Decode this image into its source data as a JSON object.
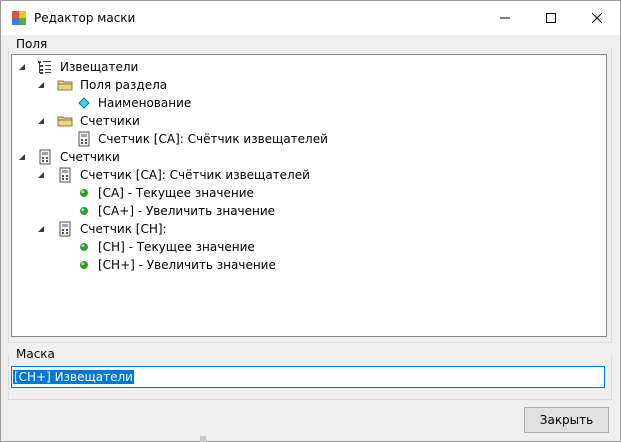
{
  "window": {
    "title": "Редактор маски"
  },
  "fields_group": {
    "label": "Поля"
  },
  "tree": [
    {
      "label": "Извещатели",
      "icon": "list-icon",
      "level": 0,
      "expanded": true
    },
    {
      "label": "Поля раздела",
      "icon": "folder-icon",
      "level": 1,
      "expanded": true
    },
    {
      "label": "Наименование",
      "icon": "diamond-icon",
      "level": 2,
      "expanded": null
    },
    {
      "label": "Счетчики",
      "icon": "folder-icon",
      "level": 1,
      "expanded": true
    },
    {
      "label": "Счетчик [СА]: Счётчик извещателей",
      "icon": "calculator-icon",
      "level": 2,
      "expanded": null
    },
    {
      "label": "Счетчики",
      "icon": "calculator-icon",
      "level": 0,
      "expanded": true
    },
    {
      "label": "Счетчик [СА]: Счётчик извещателей",
      "icon": "calculator-icon",
      "level": 1,
      "expanded": true
    },
    {
      "label": "[СА] - Текущее значение",
      "icon": "green-dot-icon",
      "level": 2,
      "expanded": null
    },
    {
      "label": "[СА+] - Увеличить значение",
      "icon": "green-dot-icon",
      "level": 2,
      "expanded": null
    },
    {
      "label": "Счетчик [СН]:",
      "icon": "calculator-icon",
      "level": 1,
      "expanded": true
    },
    {
      "label": "[СН] - Текущее значение",
      "icon": "green-dot-icon",
      "level": 2,
      "expanded": null
    },
    {
      "label": "[СН+] - Увеличить значение",
      "icon": "green-dot-icon",
      "level": 2,
      "expanded": null
    }
  ],
  "mask_group": {
    "label": "Маска",
    "value": "[СН+] Извещатели"
  },
  "buttons": {
    "close_label": "Закрыть"
  },
  "colors": {
    "selection": "#0078d7",
    "diamond": "#00bcd4",
    "dot": "#2e9e2e",
    "folder": "#e8d38a"
  }
}
